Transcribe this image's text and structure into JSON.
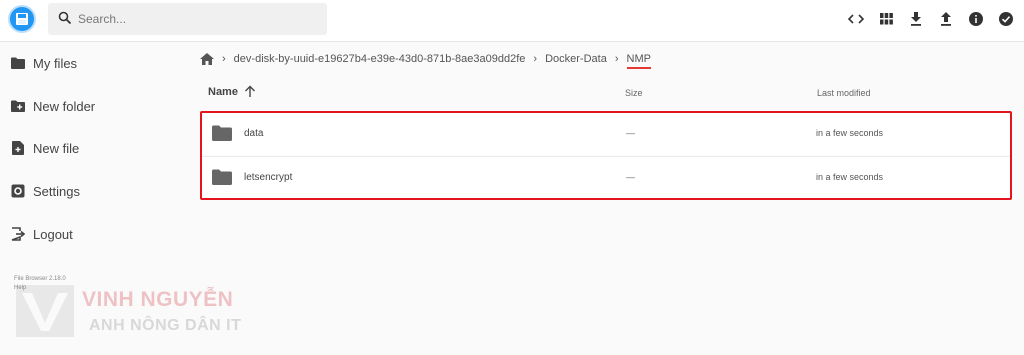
{
  "search": {
    "placeholder": "Search..."
  },
  "header": {
    "actions": [
      {
        "icon": "code-icon"
      },
      {
        "icon": "grid-view-icon"
      },
      {
        "icon": "download-icon"
      },
      {
        "icon": "upload-icon"
      },
      {
        "icon": "info-icon"
      },
      {
        "icon": "check-circle-icon"
      }
    ]
  },
  "sidebar": {
    "items": [
      {
        "label": "My files",
        "icon": "folder-icon"
      },
      {
        "label": "New folder",
        "icon": "new-folder-icon"
      },
      {
        "label": "New file",
        "icon": "new-file-icon"
      },
      {
        "label": "Settings",
        "icon": "settings-icon"
      },
      {
        "label": "Logout",
        "icon": "logout-icon"
      }
    ],
    "version": "File Browser 2.18.0",
    "help": "Help"
  },
  "breadcrumb": {
    "items": [
      "dev-disk-by-uuid-e19627b4-e39e-43d0-871b-8ae3a09dd2fe",
      "Docker-Data",
      "NMP"
    ]
  },
  "list": {
    "columns": {
      "name": "Name",
      "size": "Size",
      "modified": "Last modified"
    },
    "rows": [
      {
        "name": "data",
        "size": "—",
        "modified": "in a few seconds"
      },
      {
        "name": "letsencrypt",
        "size": "—",
        "modified": "in a few seconds"
      }
    ]
  },
  "watermark": {
    "title": "VINH NGUYỄN",
    "subtitle": "ANH NÔNG DÂN IT"
  },
  "colors": {
    "accent": "#2196f3",
    "highlight": "#e3141c"
  }
}
